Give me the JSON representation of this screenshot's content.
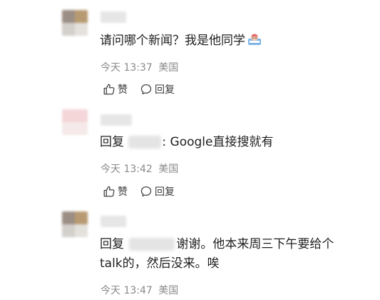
{
  "comments": [
    {
      "text": "请问哪个新闻？我是他同学",
      "time": "今天 13:37",
      "location": "美国",
      "like_label": "赞",
      "reply_label": "回复"
    },
    {
      "reply_prefix": "回复",
      "text": ": Google直接搜就有",
      "time": "今天 13:42",
      "location": "美国",
      "like_label": "赞",
      "reply_label": "回复"
    },
    {
      "reply_prefix": "回复",
      "text_line1": "谢谢。他本来周三下午要给个",
      "text_line2": "talk的，然后没来。唉",
      "time": "今天 13:47",
      "location": "美国"
    }
  ]
}
